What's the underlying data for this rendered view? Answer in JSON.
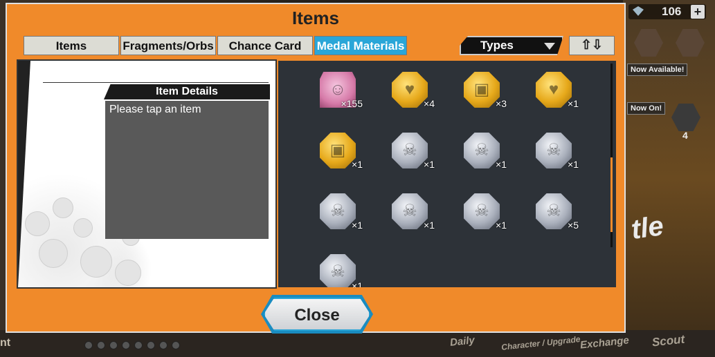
{
  "header": {
    "gems": "106",
    "gems_plus": "+"
  },
  "background": {
    "now_available": "Now Available!",
    "now_on": "Now On!",
    "nav": [
      "Daily",
      "Character / Upgrade",
      "Exchange",
      "Scout"
    ],
    "left_partial": "nt",
    "battle_partial": "tle",
    "counter": "4"
  },
  "modal": {
    "title": "Items",
    "tabs": [
      {
        "label": "Items",
        "active": false
      },
      {
        "label": "Fragments/Orbs",
        "active": false
      },
      {
        "label": "Chance Card",
        "active": false
      },
      {
        "label": "Medal Materials",
        "active": true
      }
    ],
    "filter_label": "Types",
    "sort_label": "⇧⇩",
    "details": {
      "heading": "Item Details",
      "placeholder": "Please tap an item"
    },
    "close_label": "Close"
  },
  "items": [
    {
      "name": "character-ticket",
      "style": "pink",
      "count": "×155"
    },
    {
      "name": "heart-medal-gold",
      "style": "gold",
      "count": "×4"
    },
    {
      "name": "armor-medal-gold",
      "style": "gold",
      "count": "×3"
    },
    {
      "name": "heart-medal-gold",
      "style": "gold",
      "count": "×1"
    },
    {
      "name": "armor-medal-gold",
      "style": "gold",
      "count": "×1"
    },
    {
      "name": "skull-medal-silver",
      "style": "silver",
      "count": "×1"
    },
    {
      "name": "skull-medal-silver",
      "style": "silver",
      "count": "×1"
    },
    {
      "name": "skull-medal-silver",
      "style": "silver",
      "count": "×1"
    },
    {
      "name": "skull-medal-silver",
      "style": "silver",
      "count": "×1"
    },
    {
      "name": "skull-medal-silver",
      "style": "silver",
      "count": "×1"
    },
    {
      "name": "skull-medal-silver",
      "style": "silver",
      "count": "×1"
    },
    {
      "name": "skull-medal-silver",
      "style": "silver",
      "count": "×5"
    },
    {
      "name": "skull-medal-silver",
      "style": "silver",
      "count": "×1"
    }
  ],
  "colors": {
    "accent": "#f08a2a",
    "active_tab": "#2aa6d8",
    "panel": "#2d3238"
  }
}
